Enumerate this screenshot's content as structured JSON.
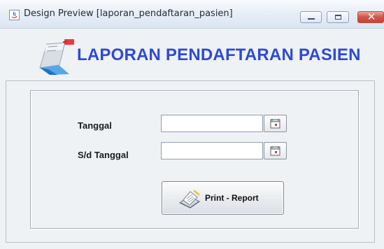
{
  "window": {
    "title": "Design Preview [laporan_pendaftaran_pasien]",
    "controls": {
      "minimize_icon": "minimize-icon",
      "maximize_icon": "maximize-icon",
      "close_icon": "close-icon",
      "close_glyph": "✕"
    }
  },
  "header": {
    "title": "LAPORAN PENDAFTARAN PASIEN",
    "icon": "report-document-icon"
  },
  "form": {
    "tanggal_label": "Tanggal",
    "sd_tanggal_label": "S/d Tanggal",
    "tanggal_value": "",
    "sd_tanggal_value": "",
    "calendar_icon": "calendar-icon"
  },
  "print_button": {
    "label": "Print - Report",
    "icon": "printer-icon"
  },
  "colors": {
    "title_text": "#2d49d8",
    "close_button": "#d3554a",
    "panel_border": "#a8afb8"
  }
}
